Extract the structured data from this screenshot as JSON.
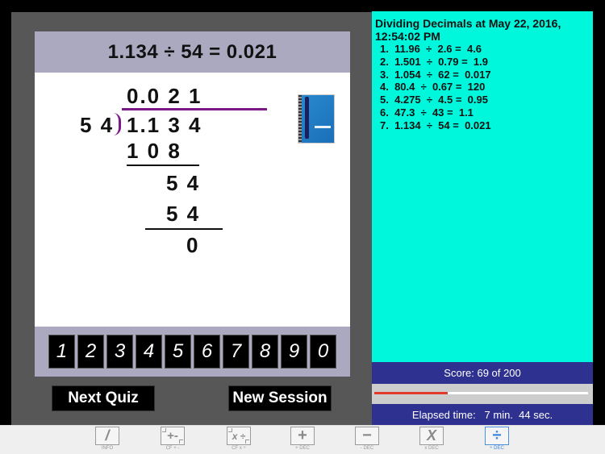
{
  "quiz": {
    "equation": "1.134  ÷  54 =  0.021",
    "long_division": {
      "quotient": "0.0 2 1",
      "divisor": "5 4",
      "dividend": "1.1 3 4",
      "steps": [
        "1 0 8",
        "5 4",
        "5 4",
        "0"
      ]
    },
    "image_icon": "notebook-with-pen-image"
  },
  "keypad": {
    "keys": [
      "1",
      "2",
      "3",
      "4",
      "5",
      "6",
      "7",
      "8",
      "9",
      "0"
    ]
  },
  "actions": {
    "next_quiz": "Next Quiz",
    "new_session": "New Session"
  },
  "history": {
    "title": "Dividing Decimals at May 22, 2016, 12:54:02 PM",
    "items": [
      "1.  11.96  ÷  2.6 =  4.6",
      "2.  1.501  ÷  0.79 =  1.9",
      "3.  1.054  ÷  62 =  0.017",
      "4.  80.4  ÷  0.67 =  120",
      "5.  4.275  ÷  4.5 =  0.95",
      "6.  47.3  ÷  43 =  1.1",
      "7.  1.134  ÷  54 =  0.021"
    ]
  },
  "score": {
    "label": "Score: 69 of 200",
    "progress_fraction": 0.345
  },
  "elapsed": {
    "label": "Elapsed time:   7 min.  44 sec."
  },
  "tabs": [
    {
      "icon": "/",
      "label": "INFO",
      "active": false
    },
    {
      "icon": "+-",
      "label": "CF + -",
      "active": false
    },
    {
      "icon": "x ÷",
      "label": "CF x ÷",
      "active": false
    },
    {
      "icon": "+",
      "label": "+ DEC",
      "active": false
    },
    {
      "icon": "−",
      "label": "- DEC",
      "active": false
    },
    {
      "icon": "X",
      "label": "x DEC",
      "active": false
    },
    {
      "icon": "÷",
      "label": "÷ DEC",
      "active": true
    }
  ],
  "colors": {
    "history_bg": "#00f7dc",
    "score_bg": "#2e3190",
    "progress_fill": "#e03a2a",
    "division_bar": "#7b1a86",
    "active_tab": "#3c86e0"
  }
}
